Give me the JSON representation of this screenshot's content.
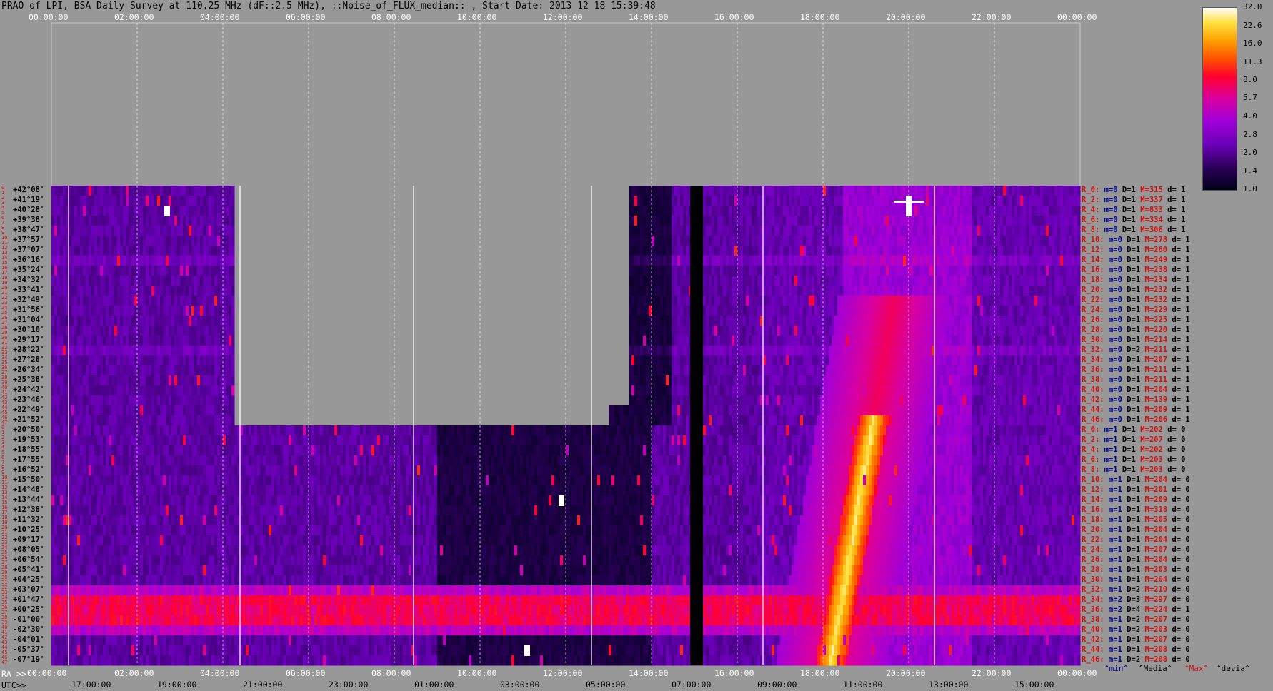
{
  "title": "PRAO of LPI, BSA Daily Survey at 110.25 MHz (dF::2.5 MHz), ::Noise_of_FLUX_median:: , Start Date: 2013 12 18 15:39:48",
  "top_axis": [
    "00:00:00",
    "02:00:00",
    "04:00:00",
    "06:00:00",
    "08:00:00",
    "10:00:00",
    "12:00:00",
    "14:00:00",
    "16:00:00",
    "18:00:00",
    "20:00:00",
    "22:00:00",
    "00:00:00"
  ],
  "ra_axis": {
    "label": "RA >>",
    "ticks": [
      "00:00:00",
      "02:00:00",
      "04:00:00",
      "06:00:00",
      "08:00:00",
      "10:00:00",
      "12:00:00",
      "14:00:00",
      "16:00:00",
      "18:00:00",
      "20:00:00",
      "22:00:00",
      "00:00:00"
    ]
  },
  "utc_axis": {
    "label": "UTC>>",
    "ticks": [
      "17:00:00",
      "19:00:00",
      "21:00:00",
      "23:00:00",
      "01:00:00",
      "03:00:00",
      "05:00:00",
      "07:00:00",
      "09:00:00",
      "11:00:00",
      "13:00:00",
      "15:00:00"
    ]
  },
  "declinations": [
    "+42°08'",
    "+41°19'",
    "+40°28'",
    "+39°38'",
    "+38°47'",
    "+37°57'",
    "+37°07'",
    "+36°16'",
    "+35°24'",
    "+34°32'",
    "+33°41'",
    "+32°49'",
    "+31°56'",
    "+31°04'",
    "+30°10'",
    "+29°17'",
    "+28°22'",
    "+27°28'",
    "+26°34'",
    "+25°38'",
    "+24°42'",
    "+23°46'",
    "+22°49'",
    "+21°52'",
    "+20°50'",
    "+19°53'",
    "+18°55'",
    "+17°55'",
    "+16°52'",
    "+15°50'",
    "+14°48'",
    "+13°44'",
    "+12°38'",
    "+11°32'",
    "+10°25'",
    "+09°17'",
    "+08°05'",
    "+06°54'",
    "+05°41'",
    "+04°25'",
    "+03°07'",
    "+01°47'",
    "+00°25'",
    "-01°00'",
    "-02°30'",
    "-04°01'",
    "-05°37'",
    "-07°19'"
  ],
  "row_numbers": [
    "0",
    "1",
    "2",
    "3",
    "4",
    "5",
    "6",
    "7",
    "8",
    "9",
    "10",
    "11",
    "12",
    "13",
    "14",
    "15",
    "16",
    "17",
    "18",
    "19",
    "20",
    "21",
    "22",
    "23",
    "24",
    "25",
    "26",
    "27",
    "28",
    "29",
    "30",
    "31",
    "32",
    "33",
    "34",
    "35",
    "36",
    "37",
    "38",
    "39",
    "40",
    "41",
    "42",
    "43",
    "44",
    "45",
    "46",
    "47",
    "0",
    "1",
    "2",
    "3",
    "4",
    "5",
    "6",
    "7",
    "8",
    "9",
    "10",
    "11",
    "12",
    "13",
    "14",
    "15",
    "16",
    "17",
    "18",
    "19",
    "20",
    "21",
    "22",
    "23",
    "24",
    "25",
    "26",
    "27",
    "28",
    "29",
    "30",
    "31",
    "32",
    "33",
    "34",
    "35",
    "36",
    "37",
    "38",
    "39",
    "40",
    "41",
    "42",
    "43",
    "44",
    "45",
    "46",
    "47"
  ],
  "stats": [
    {
      "r": "R_0:",
      "m": "m=0",
      "D": "D=1",
      "M": "M=315",
      "d": "d= 1"
    },
    {
      "r": "R_2:",
      "m": "m=0",
      "D": "D=1",
      "M": "M=337",
      "d": "d= 1"
    },
    {
      "r": "R_4:",
      "m": "m=0",
      "D": "D=1",
      "M": "M=833",
      "d": "d= 1"
    },
    {
      "r": "R_6:",
      "m": "m=0",
      "D": "D=1",
      "M": "M=334",
      "d": "d= 1"
    },
    {
      "r": "R_8:",
      "m": "m=0",
      "D": "D=1",
      "M": "M=306",
      "d": "d= 1"
    },
    {
      "r": "R_10:",
      "m": "m=0",
      "D": "D=1",
      "M": "M=278",
      "d": "d= 1"
    },
    {
      "r": "R_12:",
      "m": "m=0",
      "D": "D=1",
      "M": "M=260",
      "d": "d= 1"
    },
    {
      "r": "R_14:",
      "m": "m=0",
      "D": "D=1",
      "M": "M=249",
      "d": "d= 1"
    },
    {
      "r": "R_16:",
      "m": "m=0",
      "D": "D=1",
      "M": "M=238",
      "d": "d= 1"
    },
    {
      "r": "R_18:",
      "m": "m=0",
      "D": "D=1",
      "M": "M=234",
      "d": "d= 1"
    },
    {
      "r": "R_20:",
      "m": "m=0",
      "D": "D=1",
      "M": "M=232",
      "d": "d= 1"
    },
    {
      "r": "R_22:",
      "m": "m=0",
      "D": "D=1",
      "M": "M=232",
      "d": "d= 1"
    },
    {
      "r": "R_24:",
      "m": "m=0",
      "D": "D=1",
      "M": "M=229",
      "d": "d= 1"
    },
    {
      "r": "R_26:",
      "m": "m=0",
      "D": "D=1",
      "M": "M=225",
      "d": "d= 1"
    },
    {
      "r": "R_28:",
      "m": "m=0",
      "D": "D=1",
      "M": "M=220",
      "d": "d= 1"
    },
    {
      "r": "R_30:",
      "m": "m=0",
      "D": "D=1",
      "M": "M=214",
      "d": "d= 1"
    },
    {
      "r": "R_32:",
      "m": "m=0",
      "D": "D=2",
      "M": "M=211",
      "d": "d= 1"
    },
    {
      "r": "R_34:",
      "m": "m=0",
      "D": "D=1",
      "M": "M=207",
      "d": "d= 1"
    },
    {
      "r": "R_36:",
      "m": "m=0",
      "D": "D=1",
      "M": "M=211",
      "d": "d= 1"
    },
    {
      "r": "R_38:",
      "m": "m=0",
      "D": "D=1",
      "M": "M=211",
      "d": "d= 1"
    },
    {
      "r": "R_40:",
      "m": "m=0",
      "D": "D=1",
      "M": "M=204",
      "d": "d= 1"
    },
    {
      "r": "R_42:",
      "m": "m=0",
      "D": "D=1",
      "M": "M=139",
      "d": "d= 1"
    },
    {
      "r": "R_44:",
      "m": "m=0",
      "D": "D=1",
      "M": "M=209",
      "d": "d= 1"
    },
    {
      "r": "R_46:",
      "m": "m=0",
      "D": "D=1",
      "M": "M=206",
      "d": "d= 1"
    },
    {
      "r": "R_0:",
      "m": "m=1",
      "D": "D=1",
      "M": "M=202",
      "d": "d= 0"
    },
    {
      "r": "R_2:",
      "m": "m=1",
      "D": "D=1",
      "M": "M=207",
      "d": "d= 0"
    },
    {
      "r": "R_4:",
      "m": "m=1",
      "D": "D=1",
      "M": "M=202",
      "d": "d= 0"
    },
    {
      "r": "R_6:",
      "m": "m=1",
      "D": "D=1",
      "M": "M=203",
      "d": "d= 0"
    },
    {
      "r": "R_8:",
      "m": "m=1",
      "D": "D=1",
      "M": "M=203",
      "d": "d= 0"
    },
    {
      "r": "R_10:",
      "m": "m=1",
      "D": "D=1",
      "M": "M=204",
      "d": "d= 0"
    },
    {
      "r": "R_12:",
      "m": "m=1",
      "D": "D=1",
      "M": "M=201",
      "d": "d= 0"
    },
    {
      "r": "R_14:",
      "m": "m=1",
      "D": "D=1",
      "M": "M=209",
      "d": "d= 0"
    },
    {
      "r": "R_16:",
      "m": "m=1",
      "D": "D=1",
      "M": "M=318",
      "d": "d= 0"
    },
    {
      "r": "R_18:",
      "m": "m=1",
      "D": "D=1",
      "M": "M=205",
      "d": "d= 0"
    },
    {
      "r": "R_20:",
      "m": "m=1",
      "D": "D=1",
      "M": "M=204",
      "d": "d= 0"
    },
    {
      "r": "R_22:",
      "m": "m=1",
      "D": "D=1",
      "M": "M=204",
      "d": "d= 0"
    },
    {
      "r": "R_24:",
      "m": "m=1",
      "D": "D=1",
      "M": "M=207",
      "d": "d= 0"
    },
    {
      "r": "R_26:",
      "m": "m=1",
      "D": "D=1",
      "M": "M=204",
      "d": "d= 0"
    },
    {
      "r": "R_28:",
      "m": "m=1",
      "D": "D=1",
      "M": "M=203",
      "d": "d= 0"
    },
    {
      "r": "R_30:",
      "m": "m=1",
      "D": "D=1",
      "M": "M=204",
      "d": "d= 0"
    },
    {
      "r": "R_32:",
      "m": "m=1",
      "D": "D=2",
      "M": "M=210",
      "d": "d= 0"
    },
    {
      "r": "R_34:",
      "m": "m=2",
      "D": "D=3",
      "M": "M=297",
      "d": "d= 0"
    },
    {
      "r": "R_36:",
      "m": "m=2",
      "D": "D=4",
      "M": "M=224",
      "d": "d= 1"
    },
    {
      "r": "R_38:",
      "m": "m=1",
      "D": "D=2",
      "M": "M=207",
      "d": "d= 0"
    },
    {
      "r": "R_40:",
      "m": "m=1",
      "D": "D=2",
      "M": "M=203",
      "d": "d= 0"
    },
    {
      "r": "R_42:",
      "m": "m=1",
      "D": "D=1",
      "M": "M=207",
      "d": "d= 0"
    },
    {
      "r": "R_44:",
      "m": "m=1",
      "D": "D=1",
      "M": "M=208",
      "d": "d= 0"
    },
    {
      "r": "R_46:",
      "m": "m=1",
      "D": "D=2",
      "M": "M=208",
      "d": "d= 0"
    }
  ],
  "legend": {
    "min": "^min^",
    "median": "^Media^",
    "max": "^Max^",
    "dev": "^devia^"
  },
  "colorbar": {
    "ticks": [
      "32.0",
      "22.6",
      "16.0",
      "11.3",
      "8.0",
      "5.7",
      "4.0",
      "2.8",
      "2.0",
      "1.4",
      "1.0"
    ]
  },
  "chart_data": {
    "type": "heatmap",
    "title": "PRAO of LPI, BSA Daily Survey at 110.25 MHz (dF::2.5 MHz), ::Noise_of_FLUX_median:: , Start Date: 2013 12 18 15:39:48",
    "x_axis_top": "00:00:00 .. 00:00:00 every 2h",
    "y_axis": "declination +42°08' .. -07°19' (48 rows)",
    "colorscale": [
      "1.0",
      "1.4",
      "2.0",
      "2.8",
      "4.0",
      "5.7",
      "8.0",
      "11.3",
      "16.0",
      "22.6",
      "32.0"
    ],
    "color_range": [
      1.0,
      32.0
    ],
    "log_scale": true,
    "colors": {
      "low": "#000018",
      "mid": "#7a00d0",
      "high": "#ff2000",
      "max": "#ffffff"
    }
  }
}
